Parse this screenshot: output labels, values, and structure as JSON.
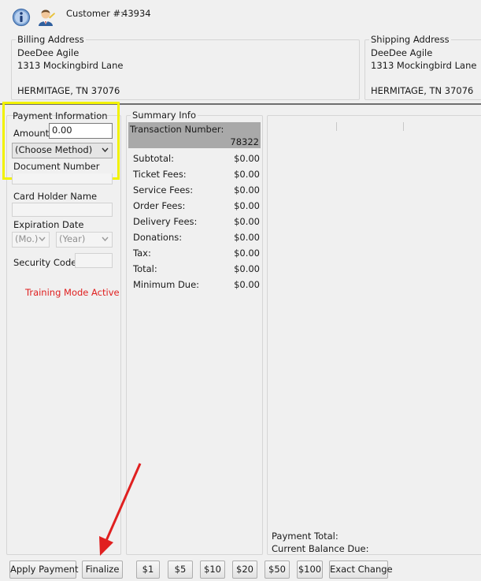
{
  "header": {
    "info_icon": "info-icon",
    "customer_icon": "customer-icon",
    "customer_label": "Customer #:",
    "customer_number": "43934"
  },
  "billing": {
    "title": "Billing Address",
    "name": "DeeDee Agile",
    "street": "1313 Mockingbird Lane",
    "city_line": "HERMITAGE, TN 37076"
  },
  "shipping": {
    "title": "Shipping Address",
    "name": "DeeDee Agile",
    "street": "1313 Mockingbird Lane",
    "city_line": "HERMITAGE, TN 37076"
  },
  "payment": {
    "title": "Payment Information",
    "amount_label": "Amount",
    "amount_value": "0.00",
    "method_selected": "(Choose Method)",
    "document_number_label": "Document Number",
    "card_holder_label": "Card Holder Name",
    "expiration_label": "Expiration Date",
    "month_selected": "(Mo.)",
    "year_selected": "(Year)",
    "security_code_label": "Security Code",
    "training_mode": "Training Mode Active",
    "highlight_color": "#f2f200"
  },
  "summary": {
    "title": "Summary Info",
    "transaction_label": "Transaction Number:",
    "transaction_number": "78322",
    "rows": [
      {
        "label": "Subtotal:",
        "value": "$0.00"
      },
      {
        "label": "Ticket Fees:",
        "value": "$0.00"
      },
      {
        "label": "Service Fees:",
        "value": "$0.00"
      },
      {
        "label": "Order Fees:",
        "value": "$0.00"
      },
      {
        "label": "Delivery Fees:",
        "value": "$0.00"
      },
      {
        "label": "Donations:",
        "value": "$0.00"
      },
      {
        "label": "Tax:",
        "value": "$0.00"
      },
      {
        "label": "Total:",
        "value": "$0.00"
      },
      {
        "label": "Minimum Due:",
        "value": "$0.00"
      }
    ]
  },
  "totals": {
    "payment_total_label": "Payment Total:",
    "current_balance_label": "Current Balance Due:"
  },
  "buttons": {
    "apply_payment": "Apply Payment",
    "finalize": "Finalize",
    "d1": "$1",
    "d5": "$5",
    "d10": "$10",
    "d20": "$20",
    "d50": "$50",
    "d100": "$100",
    "exact_change": "Exact Change"
  },
  "annotation": {
    "arrow_color": "#e02020",
    "arrow_target": "finalize"
  }
}
